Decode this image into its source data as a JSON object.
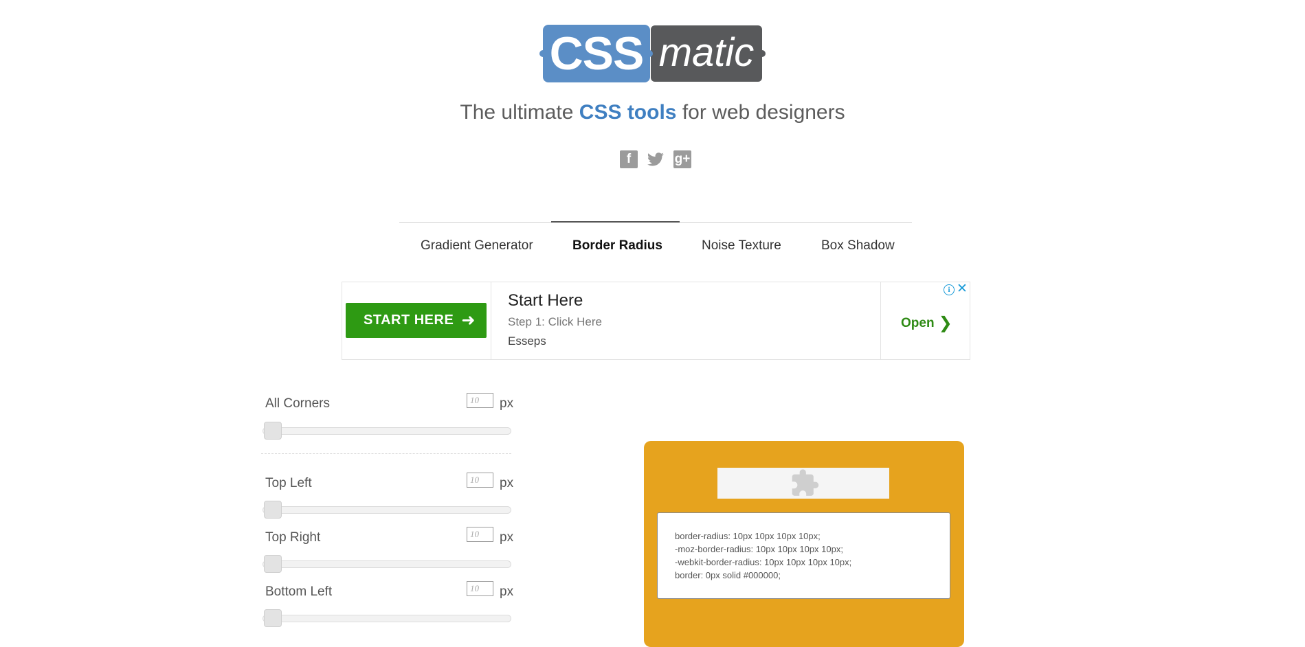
{
  "logo": {
    "left": "CSS",
    "right": "matic"
  },
  "tagline": {
    "prefix": "The ultimate ",
    "accent": "CSS tools",
    "suffix": " for web designers"
  },
  "social": [
    {
      "icon": "facebook-icon",
      "glyph": "f"
    },
    {
      "icon": "twitter-icon",
      "glyph": "🐦"
    },
    {
      "icon": "google-plus-icon",
      "glyph": "g+"
    }
  ],
  "tabs": [
    {
      "label": "Gradient Generator",
      "active": false
    },
    {
      "label": "Border Radius",
      "active": true
    },
    {
      "label": "Noise Texture",
      "active": false
    },
    {
      "label": "Box Shadow",
      "active": false
    }
  ],
  "ad": {
    "button_label": "START HERE",
    "title": "Start Here",
    "subtitle": "Step 1: Click Here",
    "brand": "Esseps",
    "open_label": "Open"
  },
  "controls": [
    {
      "label": "All Corners",
      "value": "10",
      "unit": "px"
    },
    {
      "label": "Top Left",
      "value": "10",
      "unit": "px"
    },
    {
      "label": "Top Right",
      "value": "10",
      "unit": "px"
    },
    {
      "label": "Bottom Left",
      "value": "10",
      "unit": "px"
    }
  ],
  "preview": {
    "background_color": "#e6a31e",
    "code": [
      "border-radius: 10px 10px 10px 10px;",
      "-moz-border-radius: 10px 10px 10px 10px;",
      "-webkit-border-radius: 10px 10px 10px 10px;",
      "border: 0px solid #000000;"
    ]
  }
}
